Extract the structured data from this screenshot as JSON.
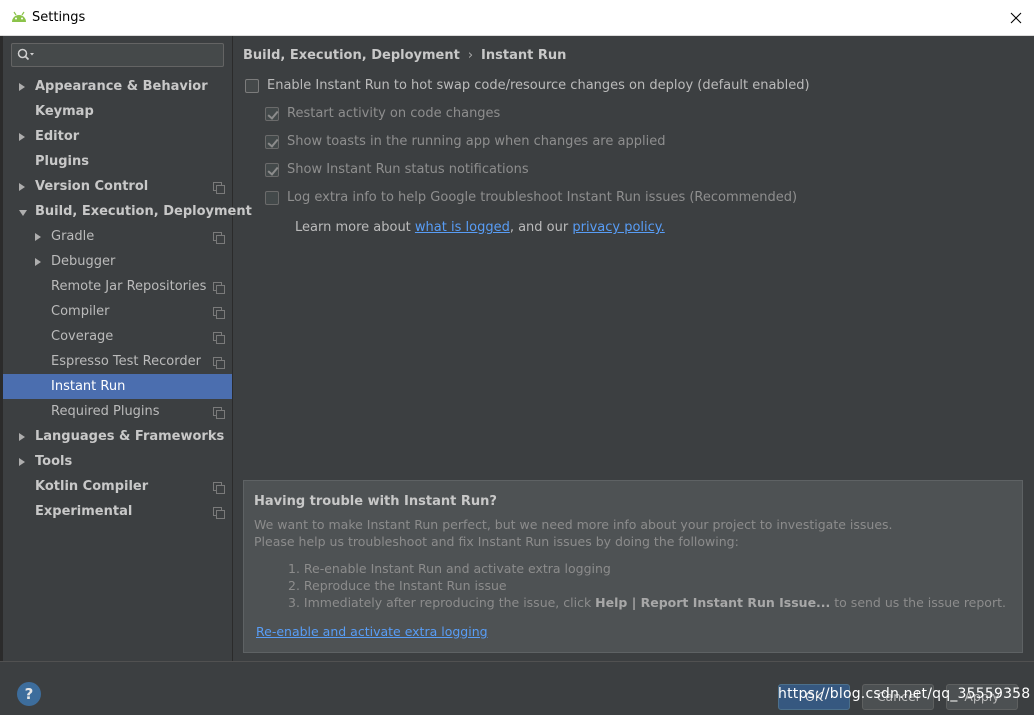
{
  "window": {
    "title": "Settings"
  },
  "sidebar": {
    "search_placeholder": "",
    "items": [
      {
        "label": "Appearance & Behavior",
        "arrow": "right",
        "bold": true,
        "indent": 0,
        "project": false
      },
      {
        "label": "Keymap",
        "arrow": "",
        "bold": true,
        "indent": 0,
        "project": false
      },
      {
        "label": "Editor",
        "arrow": "right",
        "bold": true,
        "indent": 0,
        "project": false
      },
      {
        "label": "Plugins",
        "arrow": "",
        "bold": true,
        "indent": 0,
        "project": false
      },
      {
        "label": "Version Control",
        "arrow": "right",
        "bold": true,
        "indent": 0,
        "project": true
      },
      {
        "label": "Build, Execution, Deployment",
        "arrow": "down",
        "bold": true,
        "indent": 0,
        "project": false
      },
      {
        "label": "Gradle",
        "arrow": "right",
        "bold": false,
        "indent": 1,
        "project": true
      },
      {
        "label": "Debugger",
        "arrow": "right",
        "bold": false,
        "indent": 1,
        "project": false
      },
      {
        "label": "Remote Jar Repositories",
        "arrow": "",
        "bold": false,
        "indent": 1,
        "project": true
      },
      {
        "label": "Compiler",
        "arrow": "",
        "bold": false,
        "indent": 1,
        "project": true
      },
      {
        "label": "Coverage",
        "arrow": "",
        "bold": false,
        "indent": 1,
        "project": true
      },
      {
        "label": "Espresso Test Recorder",
        "arrow": "",
        "bold": false,
        "indent": 1,
        "project": true
      },
      {
        "label": "Instant Run",
        "arrow": "",
        "bold": false,
        "indent": 1,
        "project": false,
        "selected": true
      },
      {
        "label": "Required Plugins",
        "arrow": "",
        "bold": false,
        "indent": 1,
        "project": true
      },
      {
        "label": "Languages & Frameworks",
        "arrow": "right",
        "bold": true,
        "indent": 0,
        "project": false
      },
      {
        "label": "Tools",
        "arrow": "right",
        "bold": true,
        "indent": 0,
        "project": false
      },
      {
        "label": "Kotlin Compiler",
        "arrow": "",
        "bold": true,
        "indent": 0,
        "project": true
      },
      {
        "label": "Experimental",
        "arrow": "",
        "bold": true,
        "indent": 0,
        "project": true
      }
    ]
  },
  "breadcrumb": {
    "parent": "Build, Execution, Deployment",
    "separator": "›",
    "current": "Instant Run"
  },
  "options": {
    "enable_instant_run": {
      "label": "Enable Instant Run to hot swap code/resource changes on deploy (default enabled)",
      "checked": false
    },
    "restart_activity": {
      "label": "Restart activity on code changes",
      "checked": true
    },
    "show_toasts": {
      "label": "Show toasts in the running app when changes are applied",
      "checked": true
    },
    "show_status": {
      "label": "Show Instant Run status notifications",
      "checked": true
    },
    "log_extra": {
      "label": "Log extra info to help Google troubleshoot Instant Run issues (Recommended)",
      "checked": false
    }
  },
  "learn_more": {
    "prefix": "Learn more about ",
    "link1": "what is logged",
    "middle": ", and our ",
    "link2": "privacy policy."
  },
  "trouble_panel": {
    "title": "Having trouble with Instant Run?",
    "line1": "We want to make Instant Run perfect, but we need more info about your project to investigate issues.",
    "line2": "Please help us troubleshoot and fix Instant Run issues by doing the following:",
    "step1": "1. Re-enable Instant Run and activate extra logging",
    "step2": "2. Reproduce the Instant Run issue",
    "step3_prefix": "3. Immediately after reproducing the issue, click ",
    "step3_bold": "Help | Report Instant Run Issue...",
    "step3_suffix": " to send us the issue report.",
    "link": "Re-enable and activate extra logging"
  },
  "footer": {
    "help": "?",
    "ok": "OK",
    "cancel": "Cancel",
    "apply": "Apply",
    "watermark": "https://blog.csdn.net/qq_35559358"
  },
  "colors": {
    "background": "#3c3f41",
    "selection": "#4b6eaf",
    "link": "#589df6",
    "panel": "#4e5254"
  }
}
